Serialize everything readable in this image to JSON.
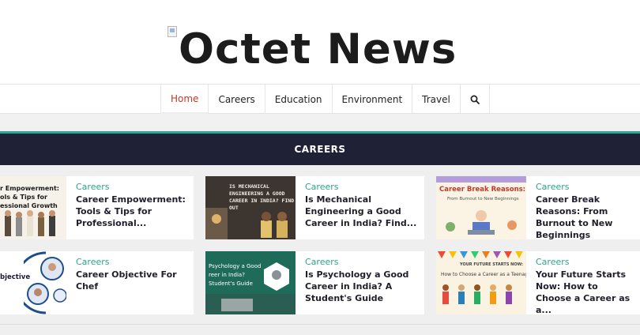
{
  "site": {
    "logo_text": "Octet News",
    "logo_broken_image": "broken-image-icon"
  },
  "nav": {
    "items": [
      {
        "label": "Home",
        "active": true
      },
      {
        "label": "Careers",
        "active": false
      },
      {
        "label": "Education",
        "active": false
      },
      {
        "label": "Environment",
        "active": false
      },
      {
        "label": "Travel",
        "active": false
      }
    ],
    "search_icon": "search-icon",
    "active_color": "#c0392b"
  },
  "section": {
    "title": "CAREERS",
    "bar_color": "#1f2136",
    "accent_line": "#28a99a"
  },
  "articles": [
    {
      "category": "Careers",
      "title": "Career Empowerment: Tools & Tips for Professional...",
      "thumb_lines": [
        "r Empowerment:",
        "ols & Tips for",
        "essional Growth"
      ]
    },
    {
      "category": "Careers",
      "title": "Is Mechanical Engineering a Good Career in India? Find...",
      "thumb_lines": [
        "IS MECHANICAL",
        "ENGINEERING A GOOD",
        "CAREER IN INDIA? FIND",
        "OUT"
      ]
    },
    {
      "category": "Careers",
      "title": "Career Break Reasons: From Burnout to New Beginnings",
      "thumb_lines": [
        "Career Break Reasons:",
        "From Burnout to New Beginnings"
      ]
    },
    {
      "category": "Careers",
      "title": "Career Objective For Chef",
      "thumb_lines": [
        "bjective"
      ]
    },
    {
      "category": "Careers",
      "title": "Is Psychology a Good Career in India? A Student's Guide",
      "thumb_lines": [
        "Psychology a Good",
        "reer in India?",
        "Student's Guide"
      ]
    },
    {
      "category": "Careers",
      "title": "Your Future Starts Now: How to Choose a Career as a...",
      "thumb_lines": [
        "YOUR FUTURE STARTS NOW:",
        "How to Choose a Career as a Teenager"
      ]
    }
  ],
  "colors": {
    "category": "#2aa58a",
    "page_bg": "#efefef"
  }
}
